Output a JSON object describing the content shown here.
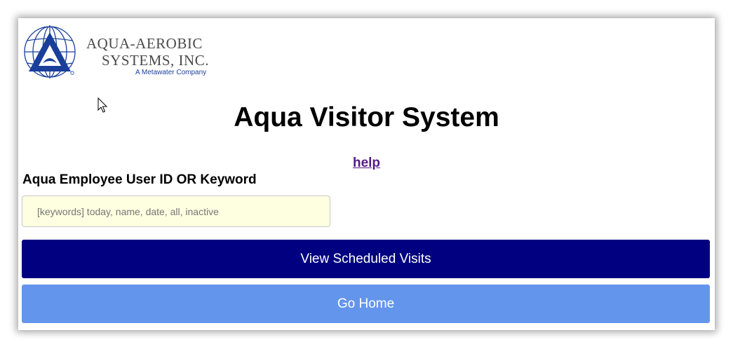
{
  "logo": {
    "line1": "AQUA-AEROBIC",
    "line2": "SYSTEMS, INC.",
    "subtitle": "A Metawater Company"
  },
  "page": {
    "title": "Aqua Visitor System",
    "help_link": "help"
  },
  "search": {
    "label": "Aqua Employee User ID OR Keyword",
    "value": "",
    "placeholder": "[keywords] today, name, date, all, inactive"
  },
  "buttons": {
    "view_visits": "View Scheduled Visits",
    "go_home": "Go Home"
  },
  "colors": {
    "primary_button": "#000080",
    "secondary_button": "#6495ed",
    "input_background": "#fefee0",
    "link": "#551a8b",
    "logo_blue": "#1a3f9a"
  },
  "icons": {
    "logo": "globe-triangle-logo-icon",
    "cursor": "mouse-pointer-icon"
  }
}
